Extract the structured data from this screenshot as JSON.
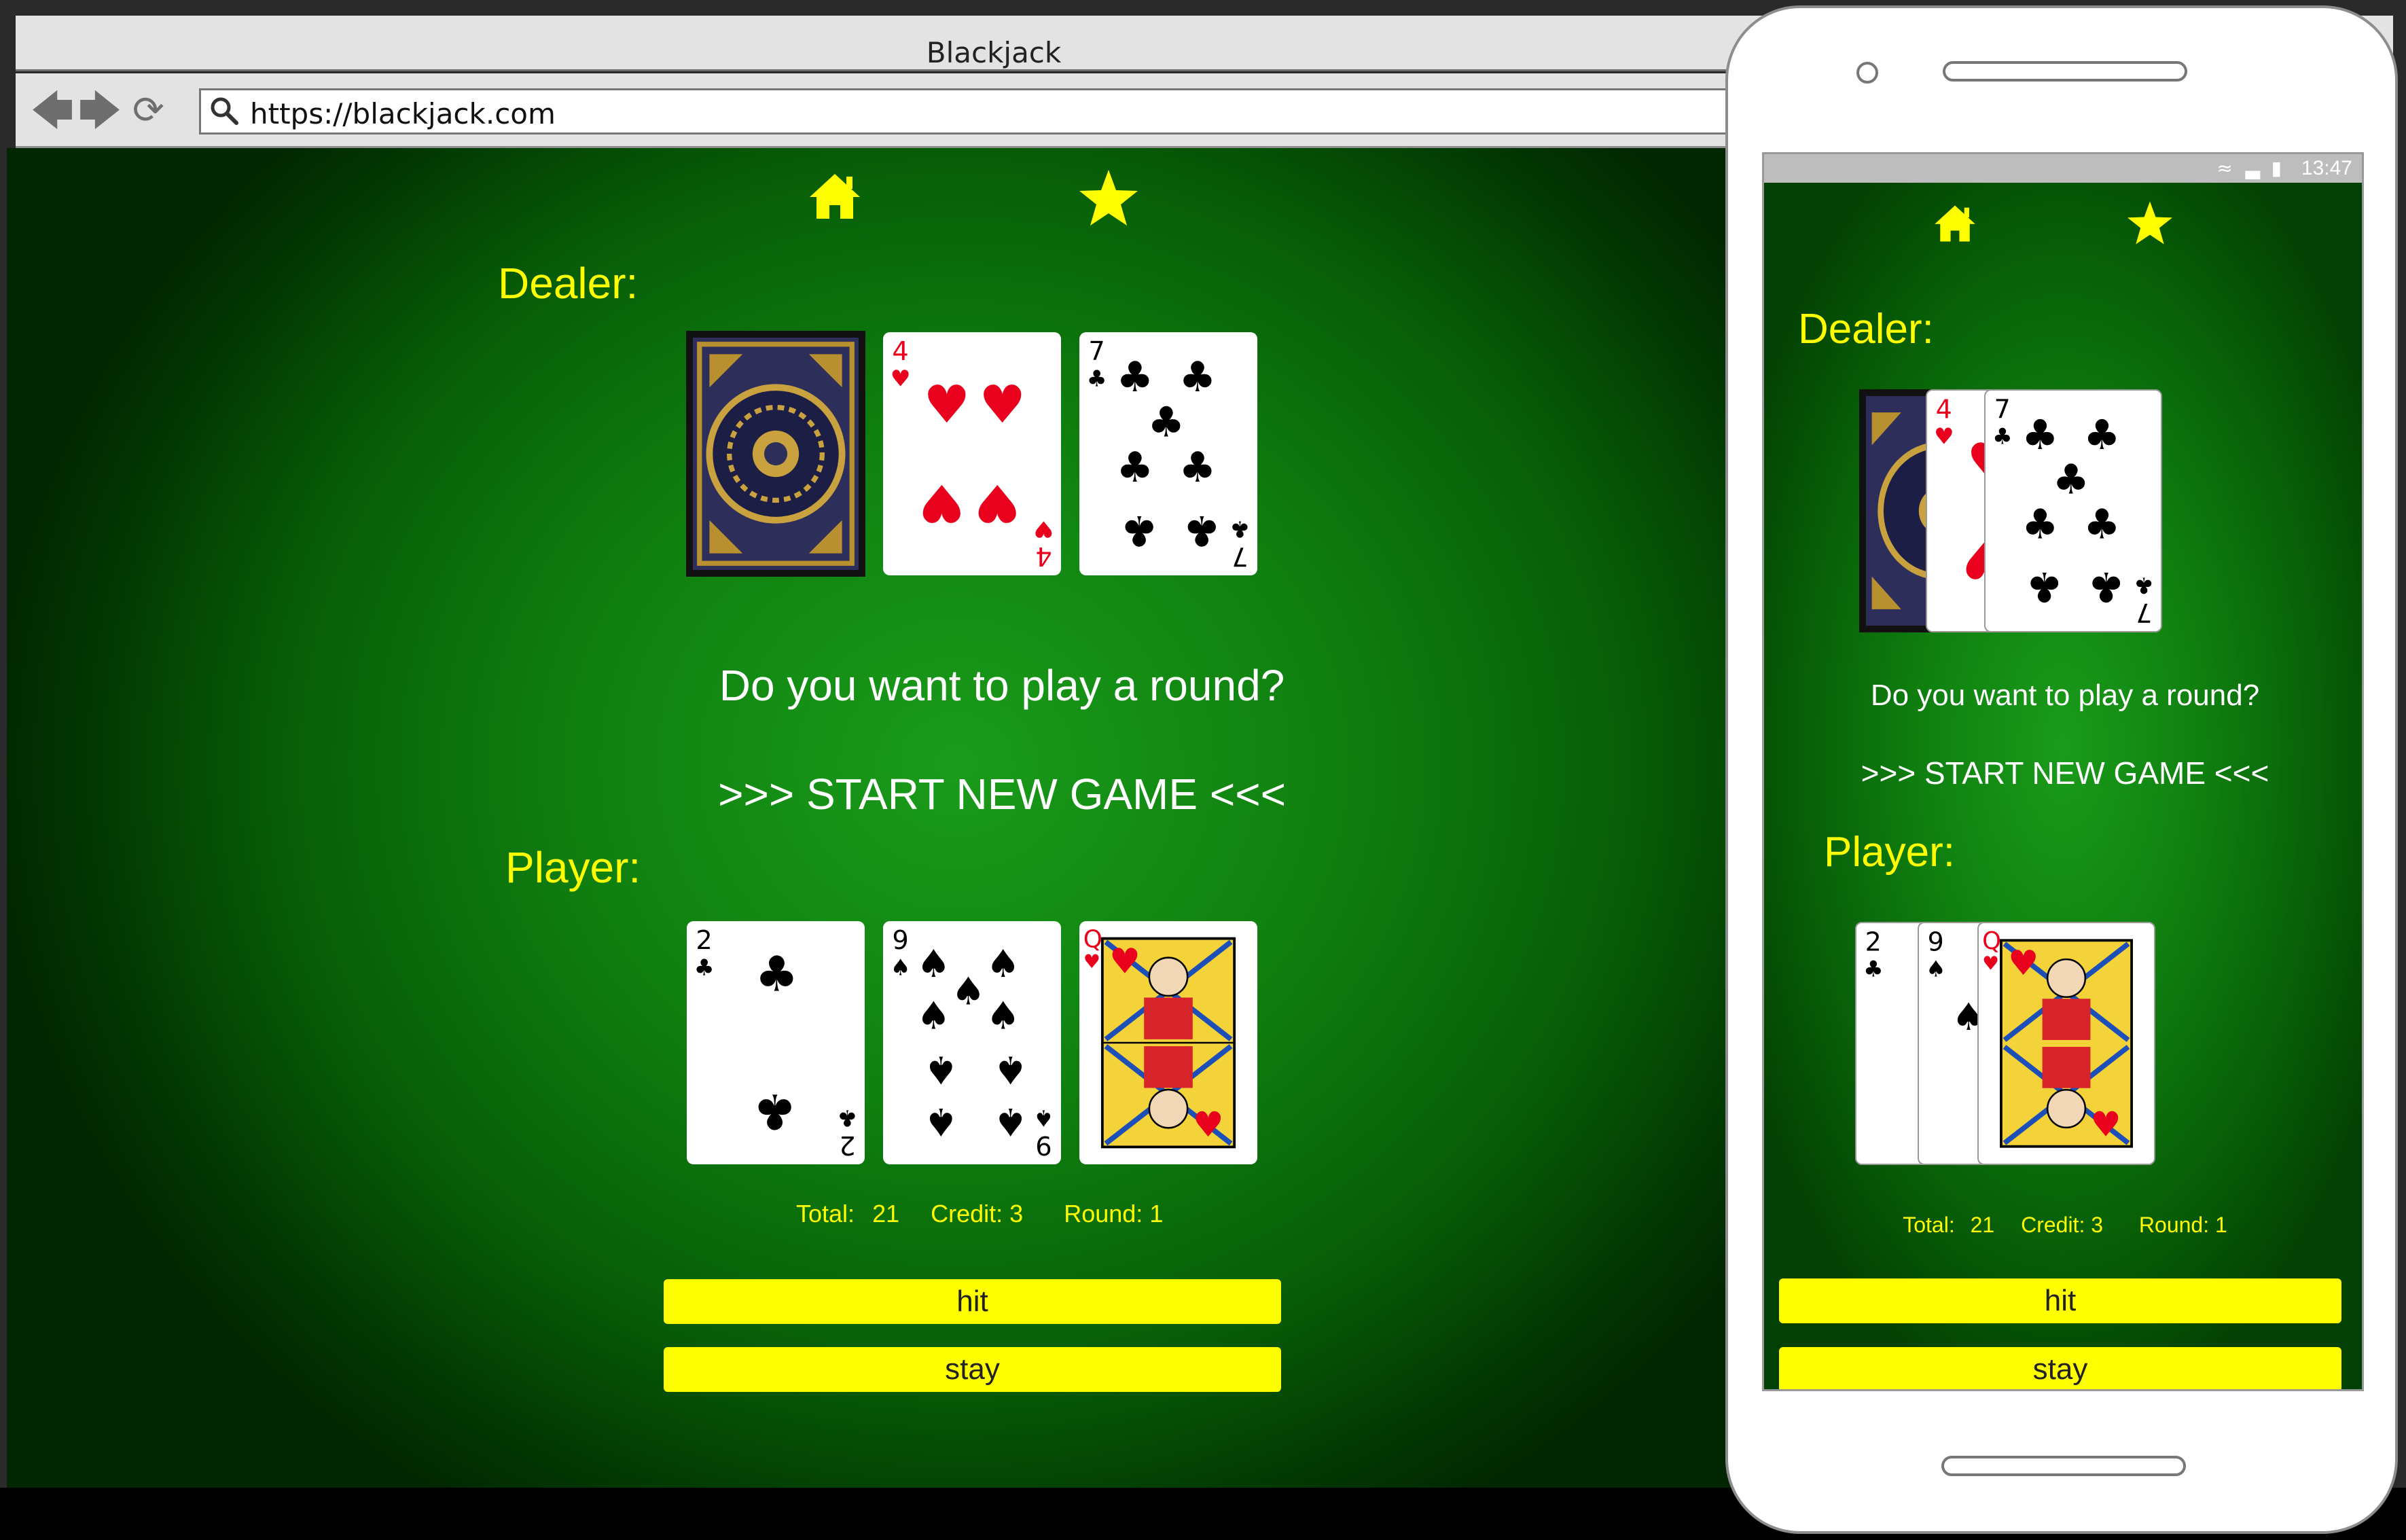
{
  "browser": {
    "title": "Blackjack",
    "url": "https://blackjack.com"
  },
  "game": {
    "dealer_label": "Dealer:",
    "player_label": "Player:",
    "prompt": "Do you want to play a round?",
    "start_label": ">>> START NEW GAME <<<",
    "stats": {
      "total_label": "Total:",
      "total_value": "21",
      "credit_label": "Credit:",
      "credit_value": "3",
      "round_label": "Round:",
      "round_value": "1"
    },
    "hit_label": "hit",
    "stay_label": "stay",
    "dealer_cards": [
      {
        "rank": "",
        "suit": "back"
      },
      {
        "rank": "4",
        "suit": "hearts"
      },
      {
        "rank": "7",
        "suit": "clubs"
      }
    ],
    "player_cards": [
      {
        "rank": "2",
        "suit": "clubs"
      },
      {
        "rank": "9",
        "suit": "spades"
      },
      {
        "rank": "Q",
        "suit": "hearts"
      }
    ]
  },
  "phone": {
    "status_time": "13:47"
  },
  "icons": {
    "home": "home-icon",
    "star": "star-icon",
    "back": "back-arrow-icon",
    "forward": "forward-arrow-icon",
    "reload": "reload-icon",
    "search": "search-icon"
  },
  "colors": {
    "accent": "#ffff00",
    "felt": "#0f7f0f",
    "red_suit": "#e8001c",
    "black_suit": "#000000"
  }
}
